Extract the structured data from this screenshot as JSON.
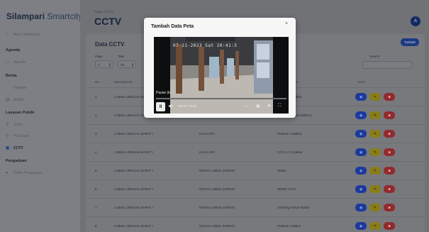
{
  "sidebar": {
    "brand_bold": "Silampari",
    "brand_rest": " Smartcity",
    "items": [
      {
        "label": "Main Dashboard",
        "icon": "home-icon"
      },
      {
        "section": "Agenda"
      },
      {
        "label": "Agenda",
        "icon": "calendar-icon"
      },
      {
        "section": "Berita"
      },
      {
        "label": "Kategori",
        "icon": "tag-icon"
      },
      {
        "label": "Artikel",
        "icon": "article-icon"
      },
      {
        "section": "Layanan Publik"
      },
      {
        "label": "Jenis",
        "icon": "pin-icon"
      },
      {
        "label": "Peta Data",
        "icon": "map-pin-icon"
      },
      {
        "label": "CCTV",
        "icon": "camera-icon",
        "active": true
      },
      {
        "section": "Pengaduan"
      },
      {
        "label": "Daftar Pengaduan",
        "icon": "alert-icon"
      }
    ]
  },
  "header": {
    "breadcrumb": "Pages / CCTV",
    "title": "CCTV",
    "avatar_letter": "A"
  },
  "card": {
    "title": "Data CCTV",
    "add_label": "Tambah",
    "page_label": "Page",
    "page_value": "1",
    "take_label": "Take",
    "take_value": "10",
    "search_label": "Search",
    "search_placeholder": ""
  },
  "table": {
    "headers": [
      "NO",
      "KECAMATAN",
      "KELURAHAN",
      "NAMA LOKASI",
      "AKSI"
    ],
    "rows": [
      {
        "no": "1",
        "kecamatan": "LUBUK LINGGAU BARAT I",
        "kelurahan": "",
        "lokasi": "Parkiran 1 Balkot"
      },
      {
        "no": "2",
        "kecamatan": "LUBUK LINGGAU BARAT I",
        "kelurahan": "",
        "lokasi": "Parkiran Masuk Balkot 2"
      },
      {
        "no": "3",
        "kecamatan": "LUBUK LINGGAU BARAT I",
        "kelurahan": "KAYU ARA",
        "lokasi": "Parkiran 2 Balkot"
      },
      {
        "no": "4",
        "kecamatan": "LUBUK LINGGAU BARAT I",
        "kelurahan": "KAYU ARA",
        "lokasi": "CCTV LT.4 Balkot"
      },
      {
        "no": "5",
        "kecamatan": "LUBUK LINGGAU BARAT I",
        "kelurahan": "WATAS LUBUK DURIAN",
        "lokasi": "Watas"
      },
      {
        "no": "6",
        "kecamatan": "LUBUK LINGGAU BARAT I",
        "kelurahan": "WATAS LUBUK DURIAN",
        "lokasi": "DEMO CCTV"
      },
      {
        "no": "7",
        "kecamatan": "LUBUK LINGGAU BARAT I",
        "kelurahan": "WATAS LUBUK DURIAN",
        "lokasi": "Gerbang Keluar Balkot"
      },
      {
        "no": "8",
        "kecamatan": "LUBUK LINGGAU BARAT I",
        "kelurahan": "WATAS LUBUK DURIAN",
        "lokasi": "Parkiran I Balkot"
      }
    ]
  },
  "modal": {
    "title": "Tambah Data Peta",
    "close_symbol": "×",
    "timestamp": "07-21-2023 Sat 20:41:5",
    "pause_label": "Pause (k)",
    "time_display": "00:00 / 00:05"
  },
  "colors": {
    "brand_blue": "#1d3a82",
    "view_button": "#1c3a9c",
    "edit_button": "#8a7d18",
    "delete_button": "#922a2e"
  }
}
